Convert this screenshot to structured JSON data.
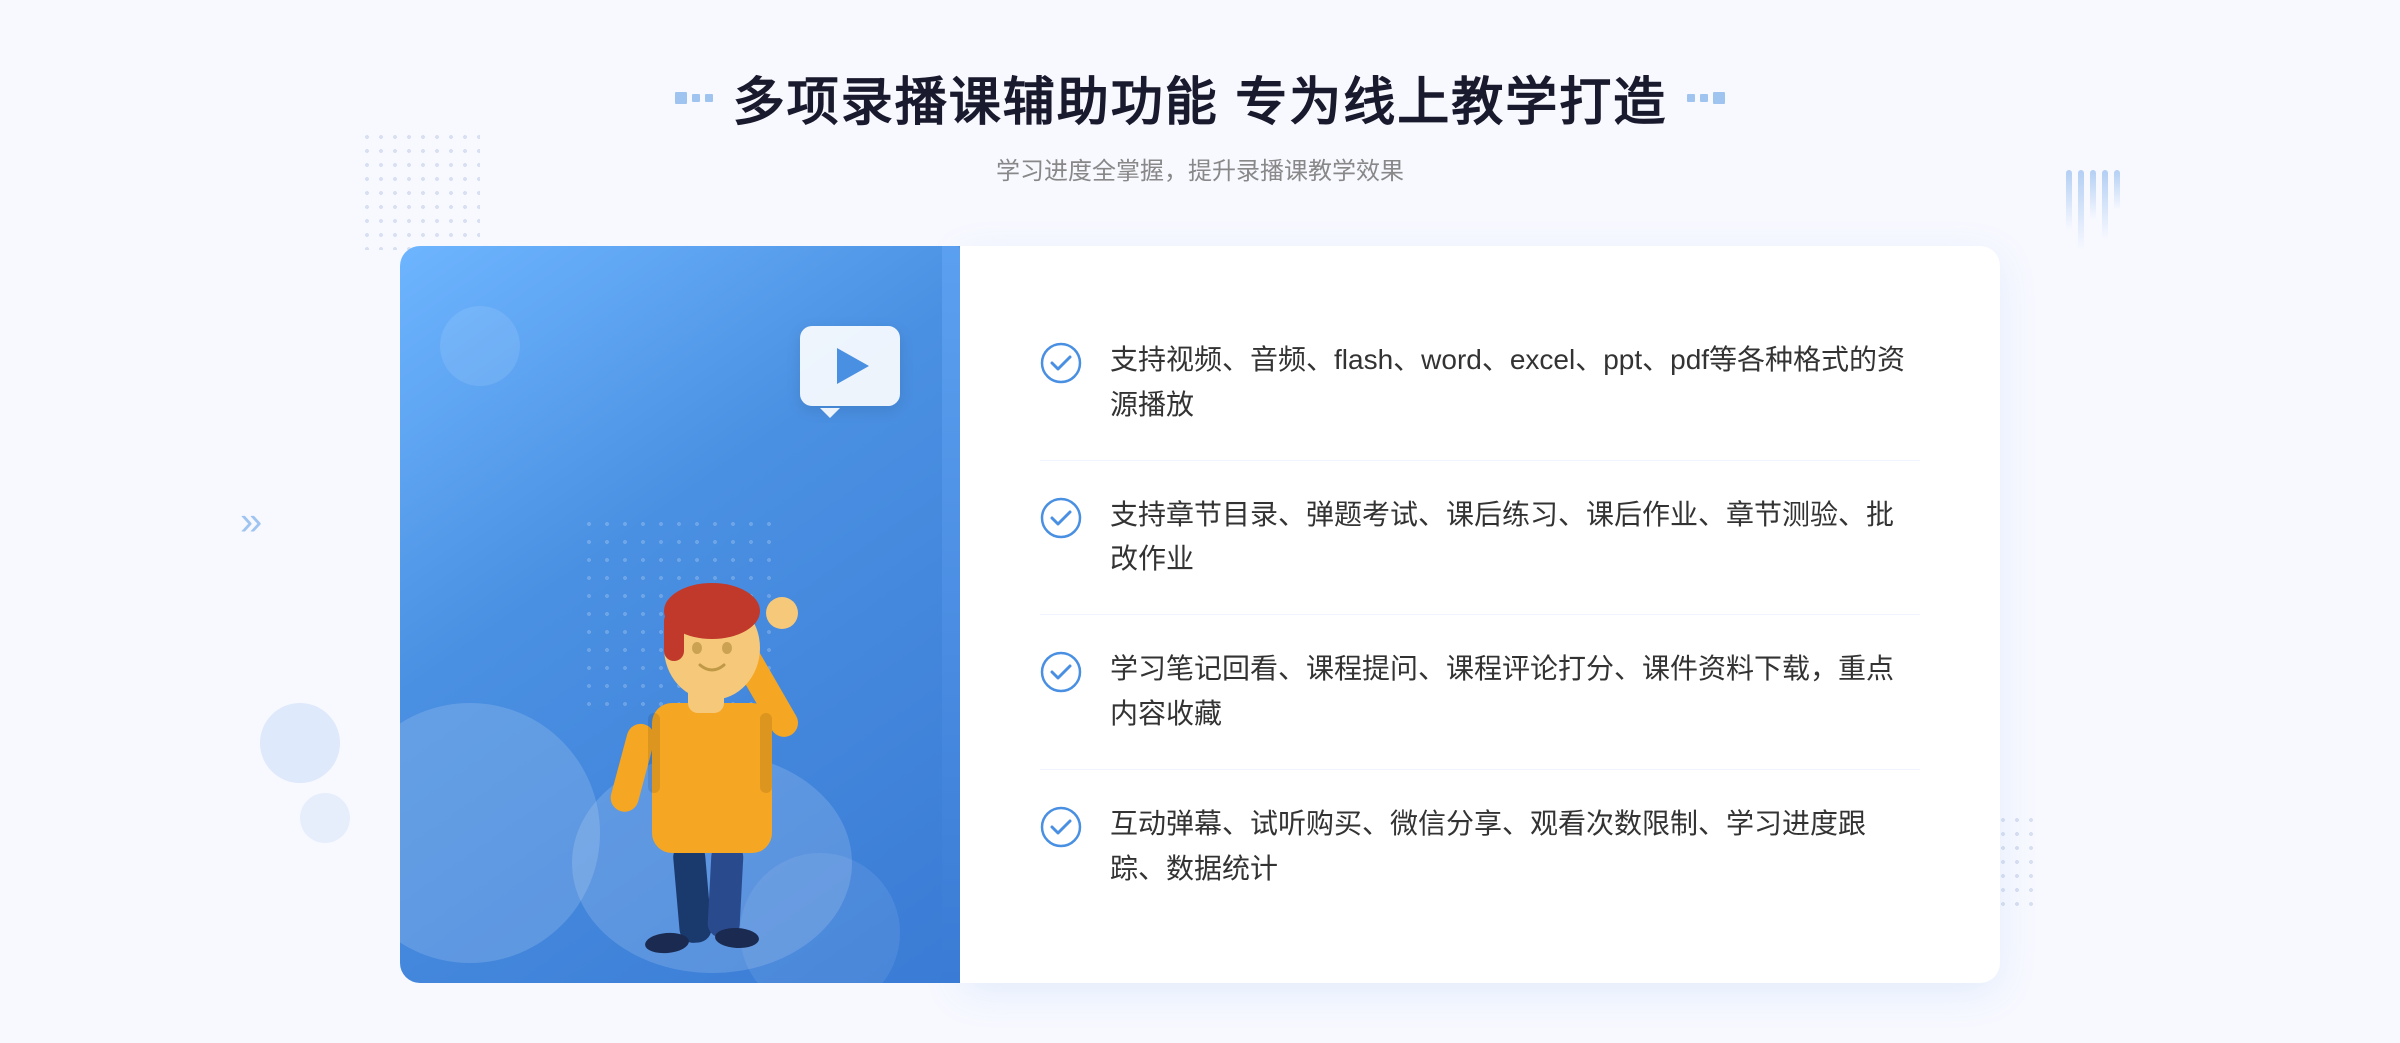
{
  "header": {
    "title": "多项录播课辅助功能 专为线上教学打造",
    "subtitle": "学习进度全掌握，提升录播课教学效果",
    "title_deco_left": "decorative-dots-left",
    "title_deco_right": "decorative-dots-right"
  },
  "features": [
    {
      "id": 1,
      "text": "支持视频、音频、flash、word、excel、ppt、pdf等各种格式的资源播放"
    },
    {
      "id": 2,
      "text": "支持章节目录、弹题考试、课后练习、课后作业、章节测验、批改作业"
    },
    {
      "id": 3,
      "text": "学习笔记回看、课程提问、课程评论打分、课件资料下载，重点内容收藏"
    },
    {
      "id": 4,
      "text": "互动弹幕、试听购买、微信分享、观看次数限制、学习进度跟踪、数据统计"
    }
  ],
  "colors": {
    "primary": "#4a90e2",
    "title": "#1a1a2e",
    "text": "#333333",
    "subtitle": "#888888",
    "check": "#4a90e2",
    "bg": "#f8f9ff"
  }
}
